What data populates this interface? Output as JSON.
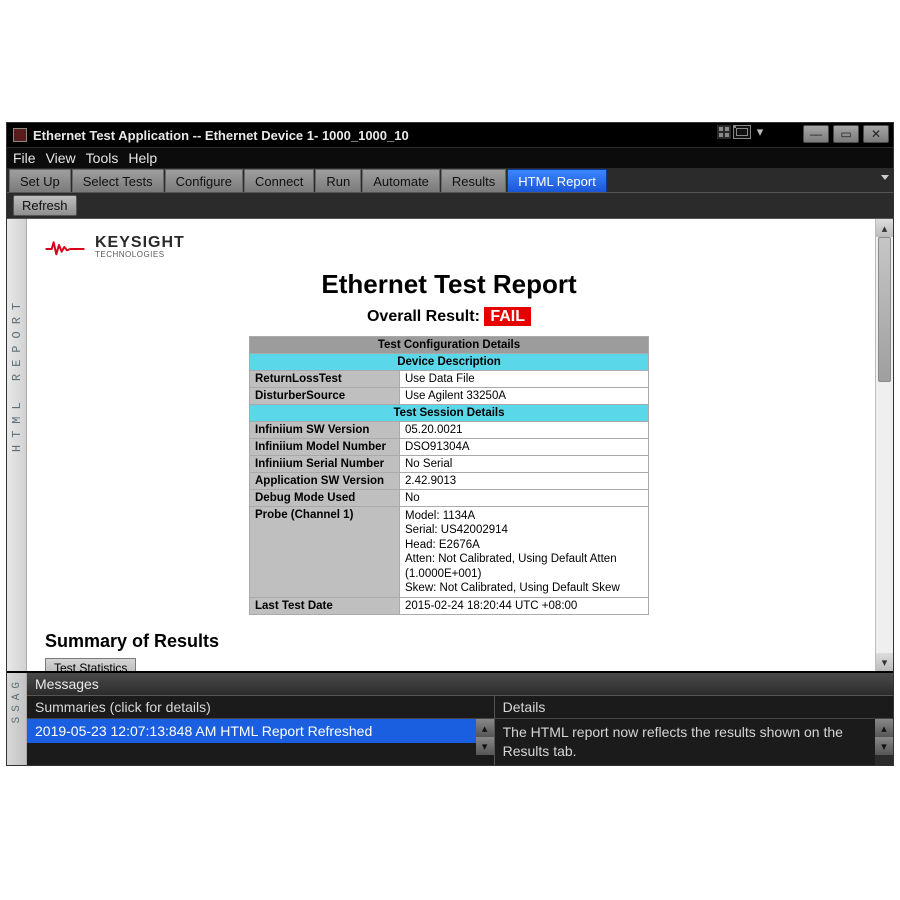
{
  "window": {
    "title": "Ethernet Test Application -- Ethernet Device 1- 1000_1000_10"
  },
  "menubar": {
    "items": [
      "File",
      "View",
      "Tools",
      "Help"
    ]
  },
  "tabs": {
    "items": [
      "Set Up",
      "Select Tests",
      "Configure",
      "Connect",
      "Run",
      "Automate",
      "Results",
      "HTML Report"
    ],
    "active": "HTML Report"
  },
  "toolbar": {
    "refresh": "Refresh"
  },
  "side_tab": {
    "label": "HTML  REPORT",
    "bottom_label": "SSAG"
  },
  "logo": {
    "brand": "KEYSIGHT",
    "subbrand": "TECHNOLOGIES"
  },
  "report": {
    "title": "Ethernet Test Report",
    "overall_label": "Overall Result:",
    "overall_value": "FAIL",
    "section_main": "Test Configuration Details",
    "section_device": "Device Description",
    "section_session": "Test Session Details",
    "rows": {
      "return_loss_k": "ReturnLossTest",
      "return_loss_v": "Use Data File",
      "dist_src_k": "DisturberSource",
      "dist_src_v": "Use Agilent 33250A",
      "sw_ver_k": "Infiniium SW Version",
      "sw_ver_v": "05.20.0021",
      "model_k": "Infiniium Model Number",
      "model_v": "DSO91304A",
      "serial_k": "Infiniium Serial Number",
      "serial_v": "No Serial",
      "app_ver_k": "Application SW Version",
      "app_ver_v": "2.42.9013",
      "debug_k": "Debug Mode Used",
      "debug_v": "No",
      "probe_k": "Probe (Channel 1)",
      "probe_v": "Model: 1134A\nSerial: US42002914\nHead: E2676A\nAtten: Not Calibrated, Using Default Atten (1.0000E+001)\nSkew: Not Calibrated, Using Default Skew",
      "last_k": "Last Test Date",
      "last_v": "2015-02-24 18:20:44 UTC +08:00"
    },
    "summary_heading": "Summary of Results",
    "stats_tab": "Test Statistics"
  },
  "messages": {
    "panel_label": "Messages",
    "summaries_header": "Summaries (click for details)",
    "details_header": "Details",
    "summary_item": "2019-05-23 12:07:13:848 AM HTML Report Refreshed",
    "details_text": "The HTML report now reflects the results shown on the Results tab."
  }
}
